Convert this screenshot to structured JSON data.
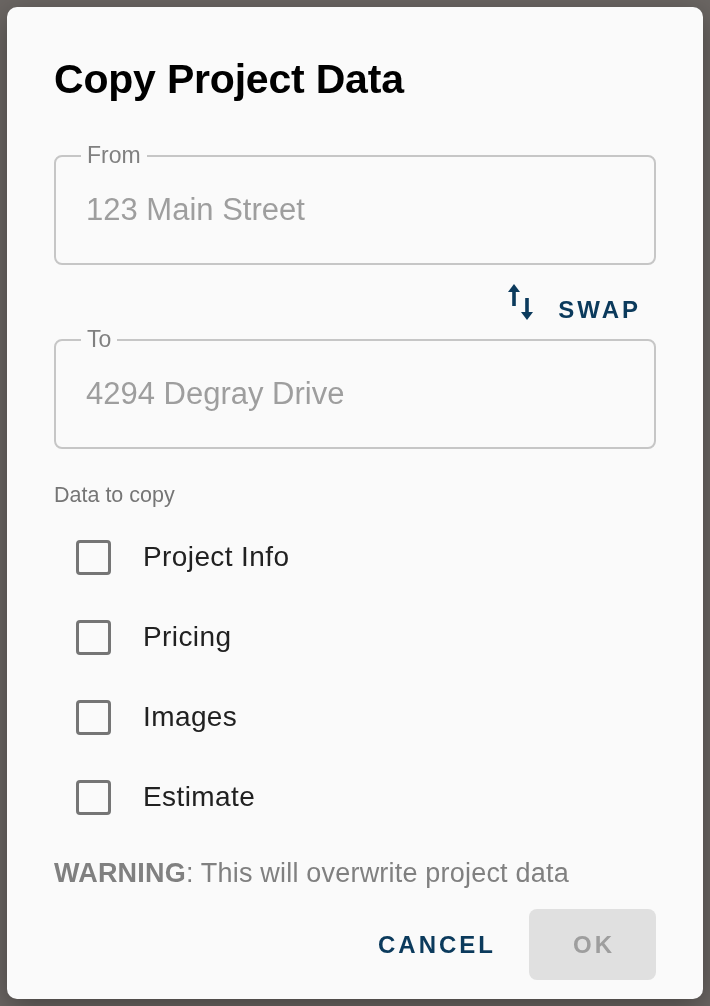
{
  "dialog": {
    "title": "Copy Project Data"
  },
  "from_field": {
    "label": "From",
    "value": "123 Main Street",
    "disabled": true
  },
  "swap_button": {
    "label": "SWAP"
  },
  "to_field": {
    "label": "To",
    "value": "4294 Degray Drive",
    "disabled": true
  },
  "data_to_copy": {
    "label": "Data to copy",
    "options": [
      {
        "label": "Project Info",
        "checked": false
      },
      {
        "label": "Pricing",
        "checked": false
      },
      {
        "label": "Images",
        "checked": false
      },
      {
        "label": "Estimate",
        "checked": false
      }
    ]
  },
  "warning": "**WARNING**: This will overwrite project data",
  "cancel_button": {
    "label": "CANCEL",
    "disabled": false
  },
  "ok_button": {
    "label": "OK",
    "disabled": true
  }
}
